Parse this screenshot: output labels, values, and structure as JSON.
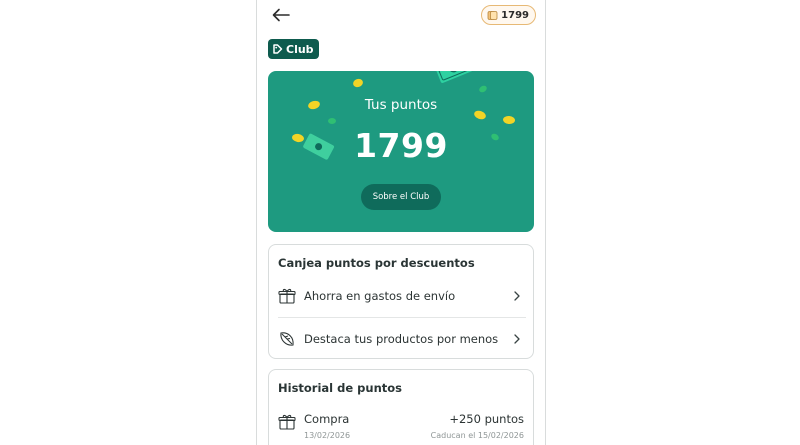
{
  "header": {
    "back_icon": "arrow-left-icon",
    "points_badge": "1799",
    "points_badge_icon": "coin-stack-icon"
  },
  "club_logo": {
    "icon": "club-logo-icon",
    "label": "Club"
  },
  "hero": {
    "title": "Tus puntos",
    "points": "1799",
    "button_label": "Sobre el Club",
    "bg_color": "#1e9a80",
    "coin_color": "#f2d426"
  },
  "redeem": {
    "title": "Canjea puntos por descuentos",
    "items": [
      {
        "label": "Ahorra en gastos de envío",
        "icon": "gift-box-icon"
      },
      {
        "label": "Destaca tus productos por menos",
        "icon": "leaf-tag-icon"
      }
    ]
  },
  "history": {
    "title": "Historial de puntos",
    "items": [
      {
        "label": "Compra",
        "date": "13/02/2026",
        "amount": "+250 puntos",
        "expiry": "Caducan el 15/02/2026",
        "icon": "gift-box-icon"
      }
    ]
  },
  "colors": {
    "brand_dark": "#0e5b4e",
    "brand": "#1e9a80",
    "badge_border": "#e7b975"
  }
}
